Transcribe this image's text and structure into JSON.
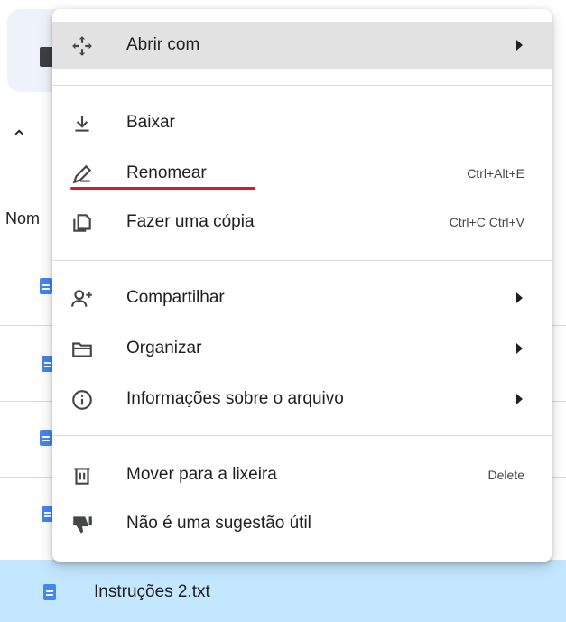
{
  "background": {
    "column_header": "Nom",
    "selected_file": {
      "name": "Instruções 2.txt"
    }
  },
  "menu": {
    "items": [
      {
        "label": "Abrir com",
        "icon": "move-icon",
        "submenu": true,
        "hovered": true
      },
      {
        "label": "Baixar",
        "icon": "download-icon"
      },
      {
        "label": "Renomear",
        "icon": "edit-pencil-icon",
        "shortcut": "Ctrl+Alt+E",
        "annotated": true
      },
      {
        "label": "Fazer uma cópia",
        "icon": "copy-icon",
        "shortcut": "Ctrl+C Ctrl+V"
      },
      {
        "label": "Compartilhar",
        "icon": "person-add-icon",
        "submenu": true
      },
      {
        "label": "Organizar",
        "icon": "folder-icon",
        "submenu": true
      },
      {
        "label": "Informações sobre o arquivo",
        "icon": "info-icon",
        "submenu": true
      },
      {
        "label": "Mover para a lixeira",
        "icon": "trash-icon",
        "shortcut": "Delete"
      },
      {
        "label": "Não é uma sugestão útil",
        "icon": "thumbs-down-icon"
      }
    ]
  },
  "colors": {
    "selected_row": "#c2e7ff",
    "hover_item": "#e2e2e2",
    "annotation_underline": "#d91b1b",
    "doc_icon": "#4285f4"
  }
}
